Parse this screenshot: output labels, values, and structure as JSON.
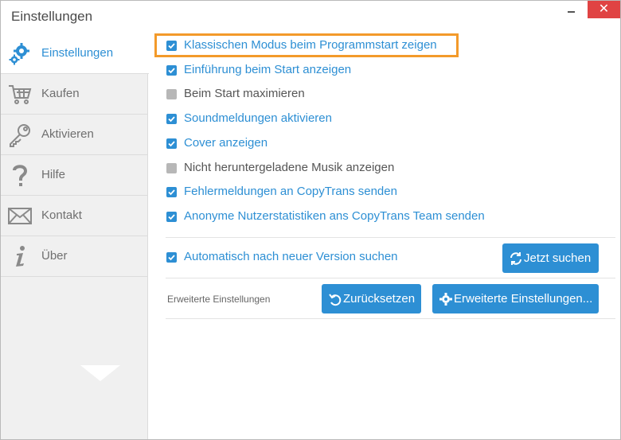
{
  "window": {
    "title": "Einstellungen",
    "close_glyph": "✕"
  },
  "sidebar": {
    "items": [
      {
        "label": "Einstellungen",
        "icon": "gears-icon",
        "active": true
      },
      {
        "label": "Kaufen",
        "icon": "cart-icon"
      },
      {
        "label": "Aktivieren",
        "icon": "key-icon"
      },
      {
        "label": "Hilfe",
        "icon": "question-icon"
      },
      {
        "label": "Kontakt",
        "icon": "envelope-icon"
      },
      {
        "label": "Über",
        "icon": "info-icon"
      }
    ]
  },
  "options": [
    {
      "label": "Klassischen Modus beim Programmstart zeigen",
      "checked": true
    },
    {
      "label": "Einführung beim Start anzeigen",
      "checked": true
    },
    {
      "label": "Beim Start maximieren",
      "checked": false
    },
    {
      "label": "Soundmeldungen aktivieren",
      "checked": true
    },
    {
      "label": "Cover anzeigen",
      "checked": true
    },
    {
      "label": "Nicht heruntergeladene Musik anzeigen",
      "checked": false
    },
    {
      "label": "Fehlermeldungen an CopyTrans senden",
      "checked": true
    },
    {
      "label": "Anonyme Nutzerstatistiken ans CopyTrans Team senden",
      "checked": true
    }
  ],
  "update": {
    "label": "Automatisch nach neuer Version suchen",
    "checked": true,
    "button": "Jetzt suchen"
  },
  "advanced": {
    "label": "Erweiterte Einstellungen",
    "reset_button": "Zurücksetzen",
    "advanced_button": "Erweiterte Einstellungen..."
  },
  "colors": {
    "accent": "#2d8fd4",
    "highlight": "#f39a2a",
    "close": "#e04343"
  }
}
